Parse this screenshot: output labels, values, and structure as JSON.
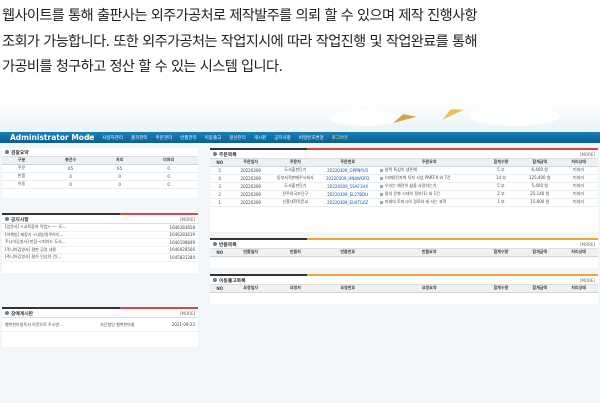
{
  "intro": {
    "line1": "웹사이트를 통해 출판사는 외주가공처로 제작발주를 의뢰 할 수 있으며 제작 진행사항",
    "line2": "조회가 가능합니다. 또한 외주가공처는 작업지시에 따라 작업진행 및 작업완료를 통해",
    "line3": "가공비를 청구하고 정산 할 수 있는 시스템 입니다."
  },
  "app": {
    "title": "Administrator Mode",
    "menu": [
      "메인",
      "사용자관리",
      "품목관리",
      "주문관리",
      "반품관리",
      "이동출고",
      "정산관리",
      "게시판",
      "공지사항",
      "비밀번호변경",
      "로그아웃"
    ]
  },
  "colors": {
    "topbar": "#0f6aa2",
    "accent_red": "#d9434a",
    "accent_orange": "#f0a53b",
    "accent_dark": "#333333",
    "link": "#1b55b5"
  },
  "summary": {
    "title": "검찰요약",
    "headers": [
      "구분",
      "총건수",
      "처리",
      "미처리"
    ],
    "rows": [
      [
        "주문",
        "65",
        "65",
        "0"
      ],
      [
        "반품",
        "0",
        "0",
        "0"
      ],
      [
        "이동",
        "0",
        "0",
        "0"
      ]
    ]
  },
  "notice": {
    "title": "공지사항",
    "more": "[MORE]",
    "items": [
      {
        "text": "[입문사] <교육합의 작법> ---- 도...",
        "date": "1646283658"
      },
      {
        "text": "[이책방] 제장가 <내일/일쿠하이...",
        "date": "1646283619"
      },
      {
        "text": "주니어김영사] 판잡-<피아드 도서...",
        "date": "1646198849"
      },
      {
        "text": "[주니어김영사] 절판 공정 내용",
        "date": "1646028566"
      },
      {
        "text": "[주니어김영사] 절가 인상의 건(...",
        "date": "1645831284"
      }
    ]
  },
  "errata": {
    "title": "장애게시판",
    "more": "[MORE]",
    "items": [
      {
        "text": "행복한아침독서 이전으로 주소변...",
        "author": "사단법인 행복한아침",
        "date": "2021-09-23"
      }
    ]
  },
  "orders": {
    "title": "주문목록",
    "more": "[MORE]",
    "headers": [
      "NO",
      "주문일자",
      "주문처",
      "주문번호",
      "주문요약",
      "합계수량",
      "합계금액",
      "처리상태"
    ],
    "rows": [
      [
        "5",
        "20220309",
        "도서출판단기",
        "20220309_GPPNPU5",
        "살짝 특십이 생존해",
        "5 부",
        "6,400 원",
        "미처리"
      ],
      [
        "4",
        "20220309",
        "동부서적판매주식회사",
        "20220309_HN8WOFD",
        "(비매)전자책 독자 사업 PART-II 외 7건",
        "14 부",
        "125,400 원",
        "미처리"
      ],
      [
        "3",
        "20220309",
        "도서출판단기",
        "20220309_5SAF1HX",
        "우리는 예전히 삶을 사랑하는가",
        "5 부",
        "5,400 원",
        "미처리"
      ],
      [
        "2",
        "20220309",
        "전주의국조단구",
        "20220309_EL27BDU",
        "말의 문화 시대의 정보(1) 외 1건",
        "2 부",
        "25,140 원",
        "미처리"
      ],
      [
        "1",
        "20220309",
        "신흥대학작문교",
        "20220309_EU4TG0Z",
        "미래의 토끼시의 경로와 세 서는 과학",
        "1 부",
        "15,600 원",
        "미처리"
      ]
    ]
  },
  "returns": {
    "title": "반품목록",
    "more": "[MORE]",
    "headers": [
      "NO",
      "반품일자",
      "반품처",
      "반품번호",
      "반품요약",
      "합계수량",
      "합계금액",
      "처리상태"
    ]
  },
  "moves": {
    "title": "이동출고목록",
    "more": "[MORE]",
    "headers": [
      "NO",
      "요청일자",
      "요청처",
      "요청번호",
      "요청요약",
      "합계수량",
      "합계금액",
      "처리상태"
    ]
  }
}
